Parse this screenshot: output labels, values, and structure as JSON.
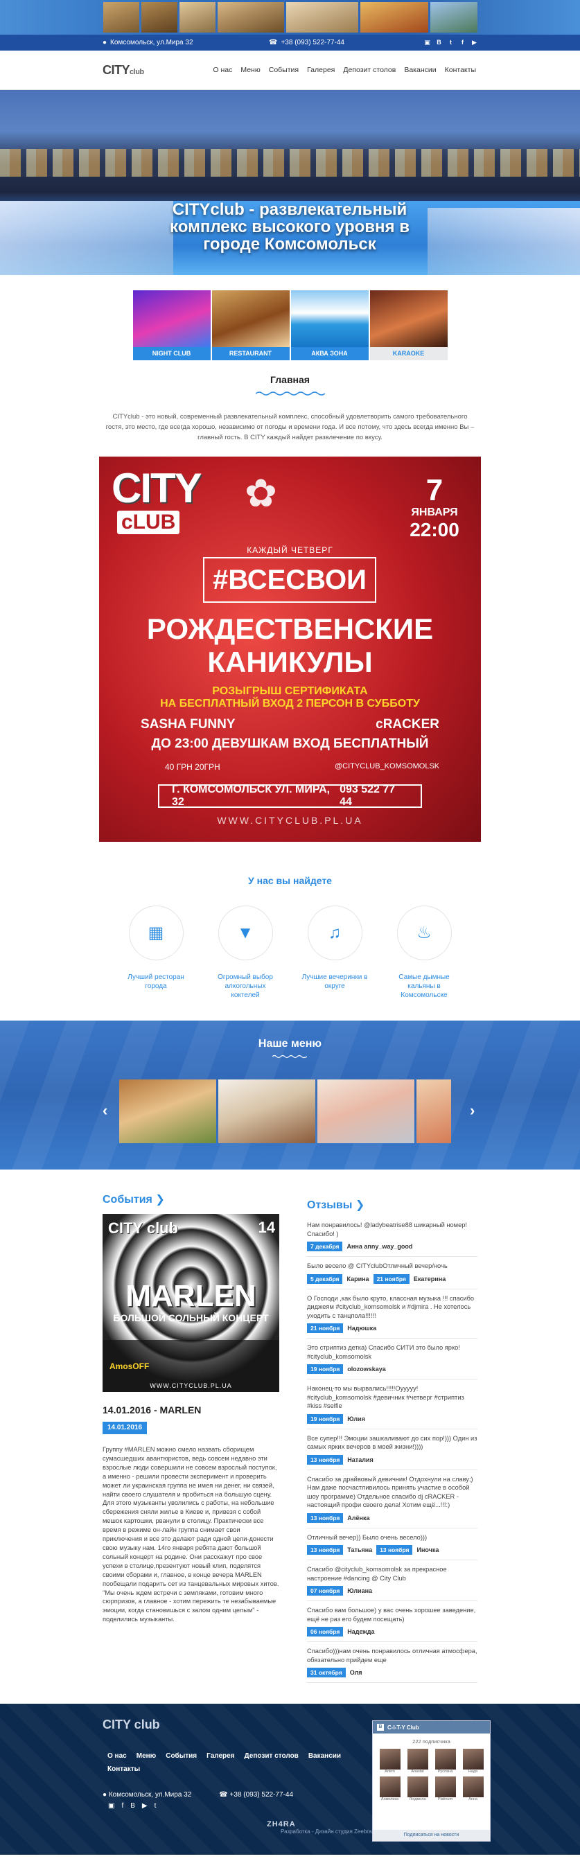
{
  "header": {
    "address": "Комсомольск, ул.Мира 32",
    "phone": "+38 (093) 522-77-44",
    "social": [
      "instagram-icon",
      "vk-icon",
      "twitter-icon",
      "facebook-icon",
      "youtube-icon"
    ]
  },
  "nav": {
    "logo": "CITY",
    "logo_sub": "club",
    "items": [
      "О нас",
      "Меню",
      "События",
      "Галерея",
      "Депозит столов",
      "Вакансии",
      "Контакты"
    ]
  },
  "hero": {
    "title": "CITYclub - развлекательный комплекс высокого уровня в городе Комсомольск"
  },
  "categories": [
    "NIGHT CLUB",
    "RESTAURANT",
    "АКВА ЗОНА",
    "KARAOKE"
  ],
  "main": {
    "title": "Главная",
    "intro": "CITYclub - это новый, современный развлекательный комплекс, способный удовлетворить самого требовательного гостя, это место, где всегда хорошо, независимо от погоды и времени года. И все потому, что здесь всегда именно Вы – главный гость. В CITY каждый найдет развлечение по вкусу."
  },
  "poster": {
    "logo": "CITY",
    "logo2": "cLUB",
    "day": "7",
    "month": "ЯНВАРЯ",
    "time": "22:00",
    "weekly": "КАЖДЫЙ ЧЕТВЕРГ",
    "tag": "#ВСЕСВОИ",
    "headline1": "РОЖДЕСТВЕНСКИЕ",
    "headline2": "КАНИКУЛЫ",
    "lottery1": "РОЗЫГРЫШ СЕРТИФИКАТА",
    "lottery2": "НА БЕСПЛАТНЫЙ ВХОД 2 ПЕРСОН В СУББОТУ",
    "dj1": "SASHA FUNNY",
    "dj2": "cRACKER",
    "free": "ДО 23:00 ДЕВУШКАМ ВХОД БЕСПЛАТНЫЙ",
    "price": "40 ГРН   20ГРН",
    "insta": "@CITYCLUB_KOMSOMOLSK",
    "address": "Г. КОМСОМОЛЬСК  УЛ. МИРА, 32",
    "phone": "093 522 77 44",
    "site": "WWW.CITYCLUB.PL.UA"
  },
  "features": {
    "title": "У нас вы найдете",
    "items": [
      {
        "icon": "book-icon",
        "text": "Лучший ресторан города"
      },
      {
        "icon": "cocktail-icon",
        "text": "Огромный выбор алкогольных коктелей"
      },
      {
        "icon": "party-icon",
        "text": "Лучшие вечеринки в округе"
      },
      {
        "icon": "hookah-icon",
        "text": "Самые дымные кальяны в Комсомольске"
      }
    ]
  },
  "menu_section": {
    "title": "Наше меню",
    "prev": "‹",
    "next": "›"
  },
  "events": {
    "heading": "События",
    "image": {
      "logo": "CITY club",
      "name": "MARLEN",
      "subtitle": "БОЛЬШОЙ СОЛЬНЫЙ КОНЦЕРТ",
      "date": "14",
      "guest": "AmosOFF",
      "site": "WWW.CITYCLUB.PL.UA"
    },
    "title": "14.01.2016 - MARLEN",
    "date": "14.01.2016",
    "text": "Группу #MARLEN можно смело назвать сборищем сумасшедших авантюристов, ведь совсем недавно эти взрослые люди совершили не совсем взрослый поступок, а именно - решили провести эксперимент и проверить может ли украинская группа не имея ни денег, ни связей, найти своего слушателя и пробиться на большую сцену. Для этого музыканты уволились с работы, на небольшие сбережения сняли жилье в Киеве и, привезя с собой мешок картошки, рванули в столицу. Практически все время в режиме он-лайн группа снимает свои приключения и все это делают ради одной цели-донести свою музыку нам. 14го января ребята дают большой сольный концерт на родине. Они расскажут про свое успехи в столице,презентуют новый клип, поделятся своими сборами и, главное, в конце вечера MARLEN пообещали подарить сет из танцевальных мировых хитов. \"Мы очень ждем встречи с земляками, готовим много сюрпризов, а главное - хотим пережить те незабываемые эмоции, когда становишься с залом одним целым\" - поделились музыканты."
  },
  "reviews": {
    "heading": "Отзывы",
    "items": [
      {
        "text": "Нам понравилось! @ladybeatrise88 шикарный номер! Спасибо! )",
        "meta": [
          {
            "date": "7 декабря",
            "name": "Анна anny_way_good"
          }
        ]
      },
      {
        "text": "Было весело @ CITYclubОтличный вечер/ночь",
        "meta": [
          {
            "date": "5 декабря",
            "name": "Карина"
          },
          {
            "date": "21 ноября",
            "name": "Екатерина"
          }
        ]
      },
      {
        "text": "О Господи ,как было круто, классная музыка !!! спасибо диджеям #cityclub_komsomolsk и #djmira . Не хотелось уходить с танцпола!!!!!!",
        "meta": [
          {
            "date": "21 ноября",
            "name": "Надюшка"
          }
        ]
      },
      {
        "text": "Это стриптиз детка) Спасибо СИТИ это было ярко! #cityclub_komsomolsk",
        "meta": [
          {
            "date": "19 ноября",
            "name": "olozowskaya"
          }
        ]
      },
      {
        "text": "Наконец-то мы вырвались!!!!!Оууууу! #cityclub_komsomolsk #девичник #четверг #стриптиз #kiss #selfie",
        "meta": [
          {
            "date": "19 ноября",
            "name": "Юлия"
          }
        ]
      },
      {
        "text": "Все супер!!! Эмоции зашкаливают до сих пор!))) Один из самых ярких вечеров в моей жизни!))))",
        "meta": [
          {
            "date": "13 ноября",
            "name": "Наталия"
          }
        ]
      },
      {
        "text": "Спасибо за драйвовый девичник! Отдохнули на славу;) Нам даже посчастливилось принять участие в особой шоу программе) Отдельное спасибо dj cRACKER - настоящий профи своего дела! Хотим ещё...!!!:)",
        "meta": [
          {
            "date": "13 ноября",
            "name": "Алёнка"
          }
        ]
      },
      {
        "text": "Отличный вечер))         Было очень весело)))",
        "meta": [
          {
            "date": "13 ноября",
            "name": "Татьяна"
          },
          {
            "date": "13 ноября",
            "name": "Иночка"
          }
        ]
      },
      {
        "text": "Спасибо @cityclub_komsomolsk за прекрасное настроение #dancing @ City Club",
        "meta": [
          {
            "date": "07 ноября",
            "name": "Юлиана"
          }
        ]
      },
      {
        "text": "Спасибо вам большое) у вас очень хорошее заведение, ещё не раз его будем посещать)",
        "meta": [
          {
            "date": "06 ноября",
            "name": "Надежда"
          }
        ]
      },
      {
        "text": "Спасибо)))нам очень понравилось отличная атмосфера, обязательно прийдем еще",
        "meta": [
          {
            "date": "31 октября",
            "name": "Оля"
          }
        ]
      }
    ]
  },
  "footer": {
    "logo": "CITY club",
    "menu": [
      "О нас",
      "Меню",
      "События",
      "Галерея",
      "Депозит столов",
      "Вакансии",
      "Контакты"
    ],
    "address": "Комсомольск, ул.Мира 32",
    "phone": "+38 (093) 522-77-44",
    "dev_logo": "ZH4RA",
    "copyright": "Разработка - Дизайн студия Zeebra",
    "widget": {
      "title": "C-I-T-Y Club",
      "count": "222 подписчика",
      "names": [
        "Artem",
        "Anastal",
        "Руслана",
        "Надя",
        "Анжелика",
        "Людмила",
        "Platinum",
        "Анна"
      ],
      "follow": "Подписаться на новости"
    }
  }
}
